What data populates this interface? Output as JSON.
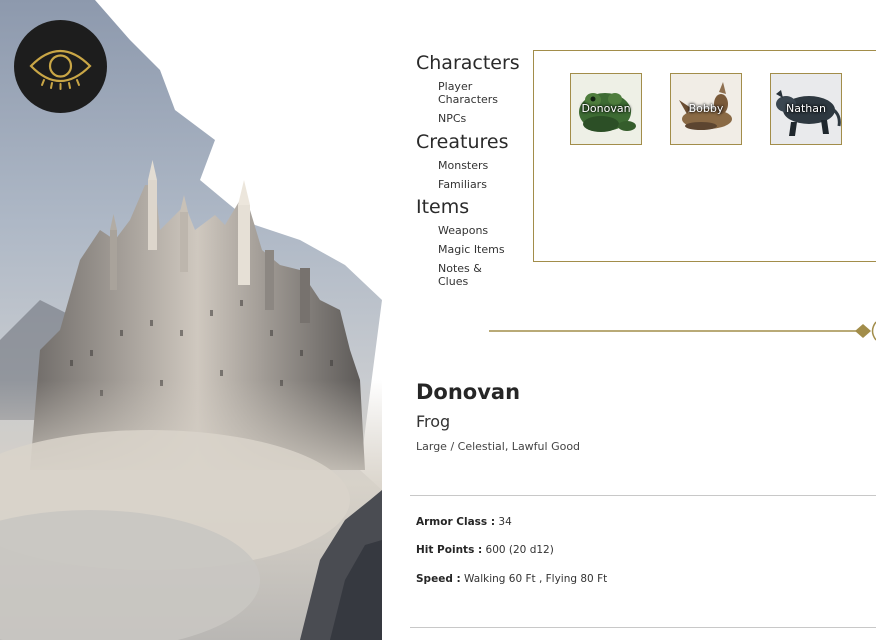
{
  "nav": {
    "sections": [
      {
        "heading": "Characters",
        "links": [
          "Player Characters",
          "NPCs"
        ]
      },
      {
        "heading": "Creatures",
        "links": [
          "Monsters",
          "Familiars"
        ]
      },
      {
        "heading": "Items",
        "links": [
          "Weapons",
          "Magic Items",
          "Notes & Clues"
        ]
      }
    ]
  },
  "gallery": {
    "cards": [
      {
        "name": "Donovan",
        "image": "frog-illustration"
      },
      {
        "name": "Bobby",
        "image": "rodent-illustration"
      },
      {
        "name": "Nathan",
        "image": "dark-beast-illustration"
      }
    ]
  },
  "detail": {
    "name": "Donovan",
    "type": "Frog",
    "meta": "Large / Celestial, Lawful Good",
    "stats": [
      {
        "label": "Armor Class :",
        "value": "34"
      },
      {
        "label": "Hit Points :",
        "value": "600 (20 d12)"
      },
      {
        "label": "Speed :",
        "value": "Walking 60 Ft , Flying 80 Ft"
      }
    ]
  },
  "icons": {
    "logo": "eye-icon",
    "divider": "diamond-ornament-icon"
  },
  "colors": {
    "accent": "#a28d4a",
    "logo_bg": "#1d1d1d",
    "logo_gold": "#c9a646"
  }
}
